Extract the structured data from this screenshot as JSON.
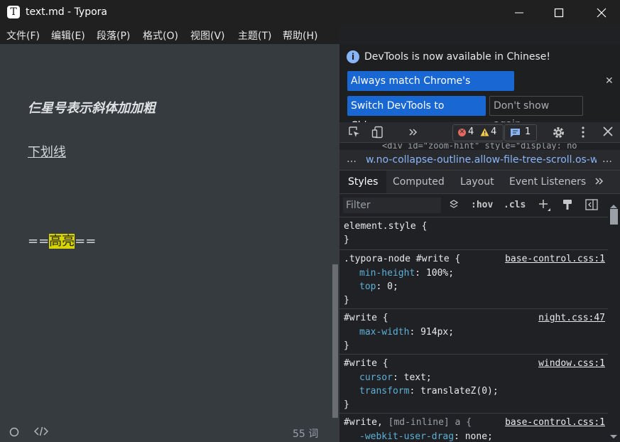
{
  "window": {
    "title": "text.md - Typora",
    "app_icon_letter": "T"
  },
  "menu": {
    "items": [
      "文件(F)",
      "编辑(E)",
      "段落(P)",
      "格式(O)",
      "视图(V)",
      "主题(T)",
      "帮助(H)"
    ]
  },
  "editor": {
    "bold_italic_text": "仨星号表示斜体加加粗",
    "underline_text": "下划线",
    "mark_prefix": "==",
    "mark_text": "高亮",
    "mark_suffix": "=="
  },
  "status": {
    "word_count": "55 词"
  },
  "devtools": {
    "info_message": "DevTools is now available in Chinese!",
    "match_language_label": "Always match Chrome's language",
    "switch_label": "Switch DevTools to Chinese",
    "dont_show_label": "Don't show again",
    "error_count": "4",
    "warning_count": "4",
    "message_count": "1",
    "html_peek": "<div id=\"zoom-hint\" style=\"display: no",
    "breadcrumb": "w.no-collapse-outline.allow-file-tree-scroll.os-windows",
    "tabs": [
      "Styles",
      "Computed",
      "Layout",
      "Event Listeners"
    ],
    "filter_placeholder": "Filter",
    "hov_label": ":hov",
    "cls_label": ".cls",
    "rules": [
      {
        "selector": "element.style {",
        "source": "",
        "declarations": []
      },
      {
        "selector": ".typora-node #write {",
        "source": "base-control.css:1",
        "declarations": [
          {
            "prop": "min-height",
            "val": "100%;"
          },
          {
            "prop": "top",
            "val": "0;"
          }
        ]
      },
      {
        "selector": "#write {",
        "source": "night.css:47",
        "declarations": [
          {
            "prop": "max-width",
            "val": "914px;"
          }
        ]
      },
      {
        "selector": "#write {",
        "source": "window.css:1",
        "declarations": [
          {
            "prop": "cursor",
            "val": "text;"
          },
          {
            "prop": "transform",
            "val": "translateZ(0);"
          }
        ]
      },
      {
        "selector_main": "#write,",
        "selector_dim": "[md-inline]",
        "selector_tail": "a {",
        "source": "base-control.css:1",
        "declarations": [
          {
            "prop": "-webkit-user-drag",
            "val": "none;"
          }
        ]
      }
    ],
    "closing_brace": "}"
  }
}
